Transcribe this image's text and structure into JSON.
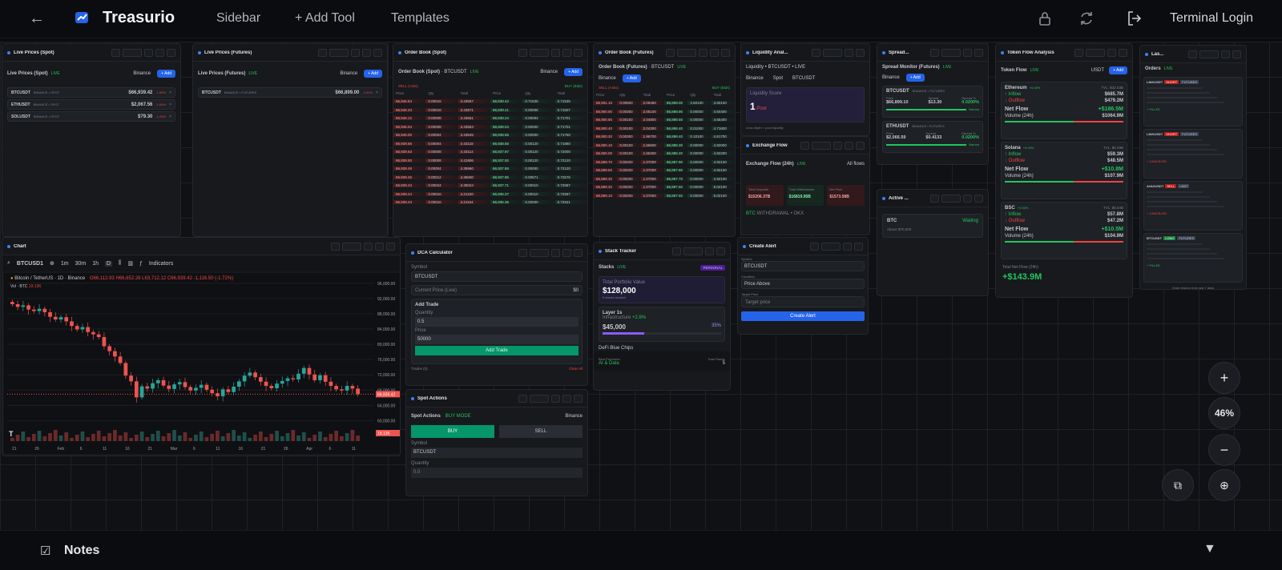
{
  "app": {
    "brand": "Treasurio",
    "nav": [
      "Sidebar",
      "+ Add Tool",
      "Templates"
    ],
    "login_label": "Terminal Login",
    "icons": [
      "back-arrow-icon",
      "lock-icon",
      "refresh-icon",
      "login-icon"
    ]
  },
  "live_spot": {
    "title": "Live Prices (Spot)",
    "header": "Live Prices (Spot)",
    "live": "LIVE",
    "exchange": "Binance",
    "add": "+ Add",
    "rows": [
      {
        "symbol": "BTCUSDT",
        "meta": "BINANCE • SPOT",
        "price": "$66,939.42",
        "change": "-1.59%"
      },
      {
        "symbol": "ETHUSDT",
        "meta": "BINANCE • SPOT",
        "price": "$2,067.56",
        "change": "-1.64%"
      },
      {
        "symbol": "SOLUSDT",
        "meta": "BINANCE • SPOT",
        "price": "$79.30",
        "change": "-1.24%"
      }
    ]
  },
  "live_futures": {
    "title": "Live Prices (Futures)",
    "header": "Live Prices (Futures)",
    "live": "LIVE",
    "exchange": "Binance",
    "add": "+ Add",
    "rows": [
      {
        "symbol": "BTCUSDT",
        "meta": "BINANCE • FUTURES",
        "price": "$66,899.00",
        "change": "-1.61%"
      }
    ]
  },
  "order_book_spot": {
    "title": "Order Book (Spot)",
    "header": "Order Book (Spot)",
    "symbol": "BTCUSDT",
    "live": "LIVE",
    "exchange": "Binance",
    "add": "+ Add",
    "sell_label": "SELL (Asks)",
    "buy_label": "BUY (Bids)",
    "cols": [
      "Price",
      "Qty",
      "Total",
      "Price",
      "Qty",
      "Total"
    ],
    "rows": [
      [
        "66,946.84",
        "0.00016",
        "4.43567",
        "66,939.42",
        "0.71535",
        "0.71535"
      ],
      [
        "66,946.43",
        "0.00016",
        "4.43571",
        "66,939.41",
        "0.00006",
        "0.71607"
      ],
      [
        "66,946.12",
        "0.00008",
        "4.43561",
        "66,939.24",
        "0.00094",
        "0.71701"
      ],
      [
        "66,946.04",
        "0.00008",
        "4.43553",
        "66,939.04",
        "0.00000",
        "0.71701"
      ],
      [
        "66,946.00",
        "0.00004",
        "4.43545",
        "66,938.55",
        "0.00000",
        "0.71760"
      ],
      [
        "66,939.66",
        "0.00004",
        "4.43118",
        "66,938.55",
        "0.00120",
        "0.71880"
      ],
      [
        "66,939.63",
        "0.00008",
        "4.43114",
        "66,937.97",
        "0.00120",
        "0.72000"
      ],
      [
        "66,939.50",
        "0.00008",
        "4.41906",
        "66,937.92",
        "0.00120",
        "0.72120"
      ],
      [
        "66,939.49",
        "0.00004",
        "4.39960",
        "66,937.86",
        "0.00000",
        "0.72120"
      ],
      [
        "66,939.45",
        "0.00012",
        "4.36600",
        "66,937.85",
        "0.00571",
        "0.72576"
      ],
      [
        "66,939.43",
        "0.00024",
        "4.35024",
        "66,937.71",
        "0.00010",
        "0.72587"
      ],
      [
        "66,939.44",
        "0.00016",
        "4.21220",
        "66,936.37",
        "0.00010",
        "0.72597"
      ],
      [
        "66,939.43",
        "0.00016",
        "4.21164",
        "66,936.36",
        "0.00000",
        "0.72621"
      ]
    ]
  },
  "order_book_futures": {
    "title": "Order Book (Futures)",
    "header": "Order Book (Futures)",
    "symbol": "BTCUSDT",
    "live": "LIVE",
    "exchange": "Binance",
    "add": "+ Add",
    "sell_label": "SELL (Asks)",
    "buy_label": "BUY (Bids)",
    "cols": [
      "Price",
      "Qty",
      "Total",
      "Price",
      "Qty",
      "Total"
    ],
    "rows": [
      [
        "66,901.10",
        "0.00600",
        "2.05480",
        "66,899.00",
        "4.60100",
        "4.60100"
      ],
      [
        "66,900.90",
        "0.00300",
        "2.05100",
        "66,898.90",
        "0.00000",
        "4.60400"
      ],
      [
        "66,900.80",
        "0.00100",
        "2.04800",
        "66,898.50",
        "0.00000",
        "4.65400"
      ],
      [
        "66,900.40",
        "0.00100",
        "2.04300",
        "66,898.40",
        "0.01000",
        "4.71600"
      ],
      [
        "66,900.20",
        "0.00300",
        "1.96700",
        "66,898.40",
        "0.10100",
        "4.81700"
      ],
      [
        "66,900.10",
        "0.00100",
        "1.56500",
        "66,898.30",
        "0.00000",
        "4.82000"
      ],
      [
        "66,900.00",
        "0.00100",
        "1.56300",
        "66,898.20",
        "0.00000",
        "4.82200"
      ],
      [
        "66,899.70",
        "0.00200",
        "1.07000",
        "66,897.90",
        "0.00000",
        "4.92100"
      ],
      [
        "66,899.50",
        "0.00200",
        "1.07000",
        "66,897.80",
        "0.00000",
        "4.92100"
      ],
      [
        "66,899.30",
        "0.00200",
        "1.07000",
        "66,897.70",
        "0.00000",
        "4.92100"
      ],
      [
        "66,899.20",
        "0.00200",
        "1.07000",
        "66,897.60",
        "0.00000",
        "5.02100"
      ],
      [
        "66,899.10",
        "0.00200",
        "1.07000",
        "66,897.50",
        "0.00000",
        "5.02100"
      ]
    ]
  },
  "liquidity": {
    "title": "Liquidity Anal...",
    "header": "Liquidity • BTCUSDT • LIVE",
    "selects": [
      "Binance",
      "Spot",
      "BTCUSDT"
    ],
    "score_label": "Liquidity Score",
    "score_value": "1",
    "score_text": "Poor",
    "footnote": "Less depth = poor liquidity"
  },
  "spread_monitor": {
    "title": "Spread...",
    "header": "Spread Monitor (Futures)",
    "live": "LIVE",
    "exchange": "Binance",
    "add": "+ Add",
    "items": [
      {
        "symbol": "BTCUSDT",
        "meta": "BINANCE • FUTURES",
        "price_label": "Price",
        "price": "$66,899.10",
        "spread_label": "Spread",
        "spread": "$13.30",
        "pct_label": "Spread %",
        "pct": "0.0200%",
        "tag": "Narrow"
      },
      {
        "symbol": "ETHUSDT",
        "meta": "BINANCE • FUTURES",
        "price_label": "Price",
        "price": "$2,066.59",
        "spread_label": "Spread",
        "spread": "$0.4133",
        "pct_label": "Spread %",
        "pct": "0.0200%",
        "tag": "Narrow"
      }
    ]
  },
  "token_flow": {
    "title": "Token Flow Analysis",
    "header": "Token Flow",
    "live": "LIVE",
    "currency": "USDT",
    "add": "+ Add",
    "tokens": [
      {
        "name": "Ethereum",
        "change": "+0.00%",
        "tvl": "TVL: $32.53B",
        "inflow": "$685.7M",
        "outflow": "$479.2M",
        "net": "+$186.5M",
        "volume": "$1064.9M"
      },
      {
        "name": "Solana",
        "change": "+0.00%",
        "tvl": "TVL: $6.29B",
        "inflow": "$59.3M",
        "outflow": "$48.5M",
        "net": "+$10.8M",
        "volume": "$107.9M"
      },
      {
        "name": "BSC",
        "change": "+0.00%",
        "tvl": "TVL: $5.54B",
        "inflow": "$57.8M",
        "outflow": "$47.2M",
        "net": "+$10.5M",
        "volume": "$104.9M"
      }
    ],
    "inflow_label": "↑ Inflow",
    "outflow_label": "↓ Outflow",
    "net_label": "Net Flow",
    "volume_label": "Volume (24h)",
    "total_label": "Total Net Flow (24h)",
    "total_value": "+$143.9M"
  },
  "orders": {
    "title": "Las...",
    "header": "Orders",
    "live": "LIVE",
    "items": [
      {
        "symbol": "LINKUSDT",
        "side": "SHORT",
        "type": "FUTURES",
        "status": "+ FILLED"
      },
      {
        "symbol": "LINKUSDT",
        "side": "SHORT",
        "type": "FUTURES",
        "status": "+ CANCELED"
      },
      {
        "symbol": "AVAXUSDT",
        "side": "SELL",
        "type": "LIMIT",
        "status": "+ CANCELED"
      },
      {
        "symbol": "BTCUSDT",
        "side": "LONG",
        "type": "FUTURES",
        "status": "+ FILLED"
      }
    ],
    "footer": "Order history from last 7 days"
  },
  "chart": {
    "title": "Chart",
    "symbol": "BTCUSD1",
    "timeframes": [
      "1m",
      "30m",
      "1h",
      "D"
    ],
    "indicators": "Indicators",
    "instrument": "Bitcoin / TetherUS · 1D · Binance",
    "ohlc": "O66,112.93 H66,652.28 L63,712.12 C66,939.42 -1,116.50 (-1.72%)",
    "vol": "Vol · BTC",
    "vol_value": "19.13K",
    "price_tag": "66,939.42",
    "vol_tag": "19.13K"
  },
  "chart_data": {
    "type": "candlestick",
    "x_ticks": [
      "21",
      "26",
      "Feb",
      "6",
      "11",
      "16",
      "21",
      "Mar",
      "6",
      "11",
      "16",
      "21",
      "26",
      "Apr",
      "6",
      "11"
    ],
    "y_ticks": [
      "96,000.00",
      "92,000.00",
      "88,000.00",
      "84,000.00",
      "80,000.00",
      "76,000.00",
      "72,000.00",
      "68,000.00",
      "64,000.00",
      "60,000.00"
    ],
    "ylim": [
      58000,
      97000
    ],
    "closes": [
      90500,
      89800,
      90200,
      89100,
      88700,
      89300,
      88400,
      87200,
      86500,
      87100,
      86000,
      84800,
      83900,
      84500,
      83200,
      82600,
      81900,
      79500,
      78200,
      76800,
      75100,
      71800,
      70300,
      66100,
      69000,
      68400,
      69800,
      70600,
      69200,
      68300,
      69500,
      70100,
      68800,
      67900,
      68600,
      69400,
      68100,
      67200,
      66400,
      68200,
      67500,
      68900,
      70300,
      71800,
      72600,
      71400,
      70200,
      69100,
      68500,
      69700,
      70400,
      71100,
      70800,
      72300,
      73800,
      72100,
      70600,
      71900,
      70200,
      69100,
      68200,
      67900,
      69100,
      68400,
      66939
    ]
  },
  "dca": {
    "title": "DCA Calculator",
    "symbol_label": "Symbol",
    "symbol": "BTCUSDT",
    "current_price_label": "Current Price (Live)",
    "current_price": "$0",
    "add_trade": "Add Trade",
    "qty_label": "Quantity",
    "qty": "0.5",
    "price_label": "Price",
    "price": "50000",
    "button": "Add Trade",
    "trades": "Trades (0)",
    "clear": "Clear All"
  },
  "spot_actions": {
    "title": "Spot Actions",
    "header": "Spot Actions",
    "mode": "BUY MODE",
    "exchange": "Binance",
    "buy": "BUY",
    "sell": "SELL",
    "symbol_label": "Symbol",
    "symbol": "BTCUSDT",
    "qty_label": "Quantity",
    "qty_placeholder": "0.0"
  },
  "stack_tracker": {
    "title": "Stack Tracker",
    "header": "Stacks",
    "live": "LIVE",
    "badge": "PERSONAL",
    "total_label": "Total Portfolio Value",
    "total_value": "$128,000",
    "total_sub": "5 stacks tracked",
    "stack_name": "Layer 1s",
    "stack_sub": "Infrastructure",
    "stack_change": "+2.8%",
    "stack_value": "$45,000",
    "stack_pct": "35%",
    "next_stack": "DeFi Blue Chips",
    "best_label": "Best Performer",
    "best_value": "AI & Data",
    "count_label": "Total Stacks",
    "count_value": "5"
  },
  "exchange_flow": {
    "title": "Exchange Flow",
    "header": "Exchange Flow (24h)",
    "live": "LIVE",
    "filter": "All flows",
    "cards": [
      {
        "label": "Total Deposits",
        "value": "$15206.37B"
      },
      {
        "label": "Total Withdrawals",
        "value": "$16819.95B"
      },
      {
        "label": "Net Flow",
        "value": "$1573.58B"
      }
    ],
    "row_symbol": "BTC",
    "row_meta": "WITHDRAWAL • OKX"
  },
  "active_alerts": {
    "title": "Active ...",
    "symbol": "BTC",
    "status": "Waiting",
    "sub": "Above $70,000"
  },
  "create_alert": {
    "title": "Create Alert",
    "symbol_label": "Symbol",
    "symbol": "BTCUSDT",
    "condition_label": "Condition",
    "condition": "Price Above",
    "target_label": "Target Price",
    "target_placeholder": "Target price",
    "button": "Create Alert"
  },
  "zoom": {
    "plus": "+",
    "minus": "−",
    "level": "46%"
  },
  "notes": {
    "label": "Notes"
  },
  "colors": {
    "accent": "#2563eb",
    "up": "#22c55e",
    "down": "#ef4444",
    "bg": "#101114"
  }
}
